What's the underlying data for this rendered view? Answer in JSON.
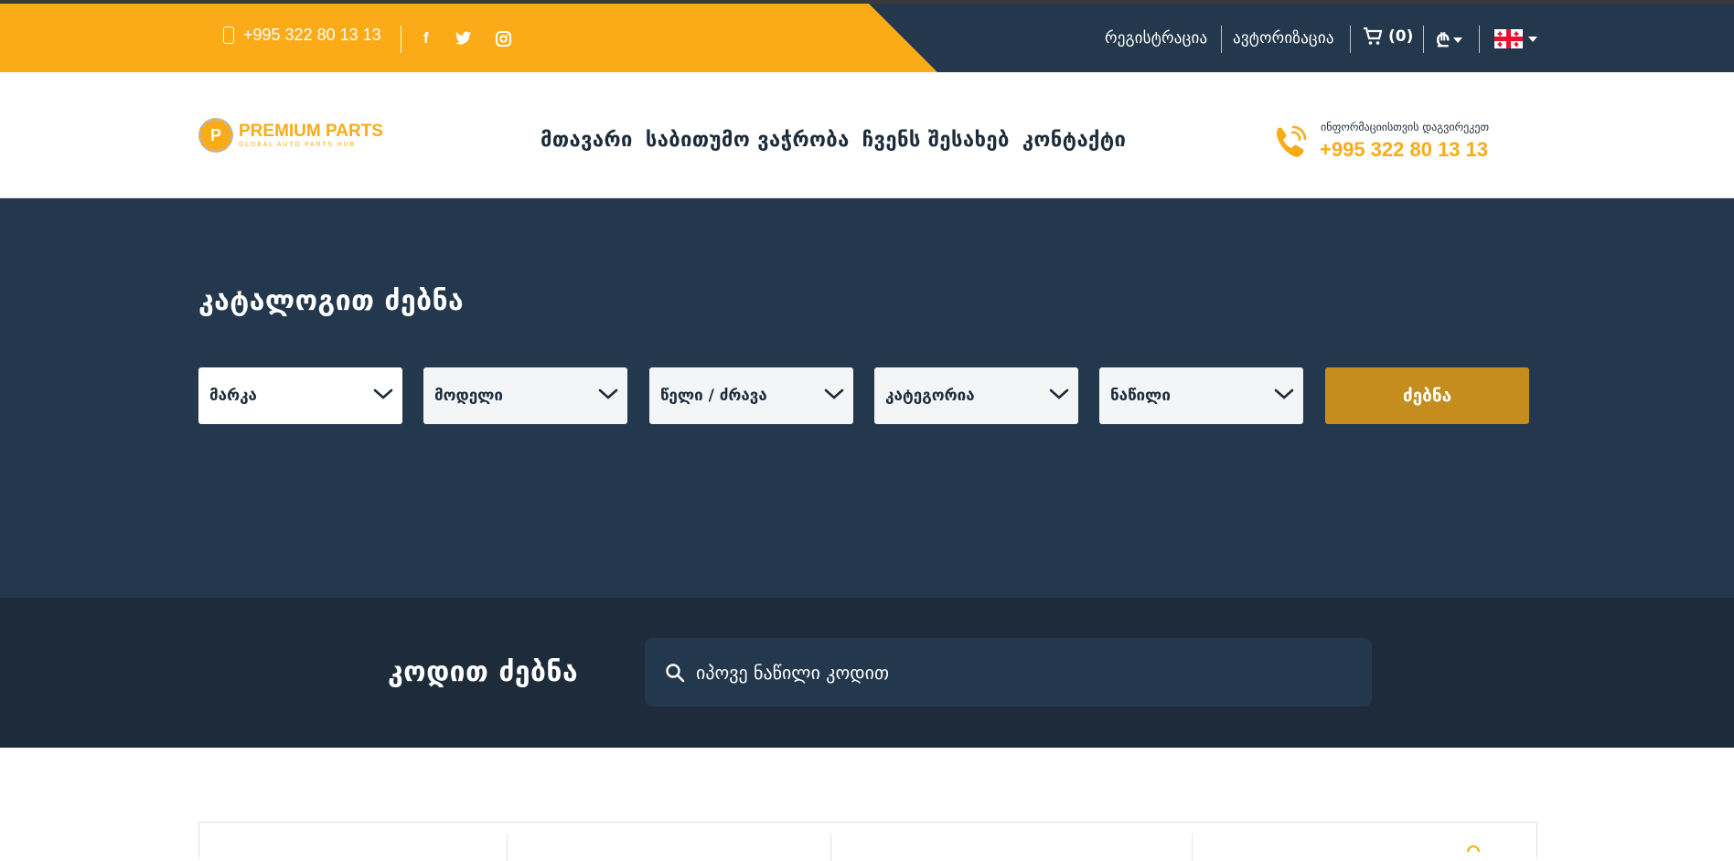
{
  "topbar": {
    "phone": "+995 322 80 13 13",
    "social": {
      "facebook": "f",
      "twitter": "twitter-icon",
      "instagram": "instagram-icon"
    },
    "register": "რეგისტრაცია",
    "login": "ავტორიზაცია",
    "cart_count": "(0)",
    "currency_symbol": "₾",
    "language": "ka"
  },
  "header": {
    "logo_title": "PREMIUM PARTS",
    "logo_subtitle": "GLOBAL AUTO PARTS HUB",
    "logo_letter": "P",
    "nav": [
      "მთავარი",
      "საბითუმო ვაჭრობა",
      "ჩვენს შესახებ",
      "კონტაქტი"
    ],
    "info_label": "ინფორმაციისთვის დაგვირეკეთ",
    "info_phone": "+995 322 80 13 13"
  },
  "catalog": {
    "title": "კატალოგით ძებნა",
    "selects": [
      "მარკა",
      "მოდელი",
      "წელი / ძრავა",
      "კატეგორია",
      "ნაწილი"
    ],
    "search_button": "ძებნა"
  },
  "code_search": {
    "title": "კოდით ძებნა",
    "placeholder": "იპოვე ნაწილი კოდით"
  },
  "colors": {
    "accent": "#fbab18",
    "dark": "#24384d",
    "darker": "#1d2b3a",
    "button": "#c48d1e"
  }
}
